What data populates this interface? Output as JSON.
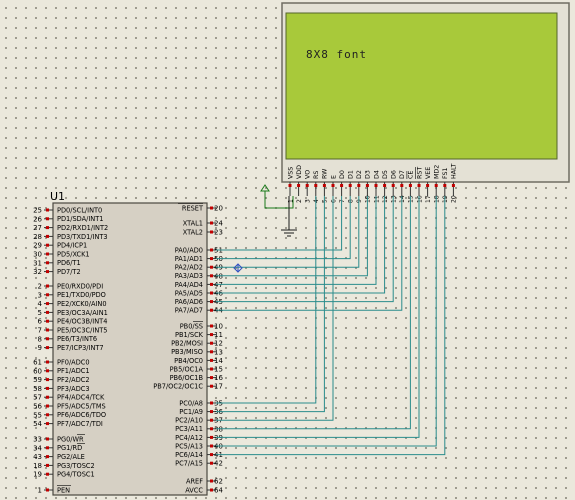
{
  "mcu": {
    "ref": "U1",
    "left_pins": [
      {
        "num": "25",
        "label": "PD0/SCL/INT0"
      },
      {
        "num": "26",
        "label": "PD1/SDA/INT1"
      },
      {
        "num": "27",
        "label": "PD2/RXD1/INT2"
      },
      {
        "num": "28",
        "label": "PD3/TXD1/INT3"
      },
      {
        "num": "29",
        "label": "PD4/ICP1"
      },
      {
        "num": "30",
        "label": "PD5/XCK1"
      },
      {
        "num": "31",
        "label": "PD6/T1"
      },
      {
        "num": "32",
        "label": "PD7/T2"
      },
      {
        "num": "2",
        "label": "PE0/RXD0/PDI"
      },
      {
        "num": "3",
        "label": "PE1/TXD0/PDO"
      },
      {
        "num": "4",
        "label": "PE2/XCK0/AIN0"
      },
      {
        "num": "5",
        "label": "PE3/OC3A/AIN1"
      },
      {
        "num": "6",
        "label": "PE4/OC3B/INT4"
      },
      {
        "num": "7",
        "label": "PE5/OC3C/INT5"
      },
      {
        "num": "8",
        "label": "PE6/T3/INT6"
      },
      {
        "num": "9",
        "label": "PE7/ICP3/INT7"
      },
      {
        "num": "61",
        "label": "PF0/ADC0"
      },
      {
        "num": "60",
        "label": "PF1/ADC1"
      },
      {
        "num": "59",
        "label": "PF2/ADC2"
      },
      {
        "num": "58",
        "label": "PF3/ADC3"
      },
      {
        "num": "57",
        "label": "PF4/ADC4/TCK"
      },
      {
        "num": "56",
        "label": "PF5/ADC5/TMS"
      },
      {
        "num": "55",
        "label": "PF6/ADC6/TDO"
      },
      {
        "num": "54",
        "label": "PF7/ADC7/TDI"
      },
      {
        "num": "33",
        "label": "PG0/WR"
      },
      {
        "num": "34",
        "label": "PG1/RD"
      },
      {
        "num": "43",
        "label": "PG2/ALE"
      },
      {
        "num": "18",
        "label": "PG3/TOSC2"
      },
      {
        "num": "19",
        "label": "PG4/TOSC1"
      },
      {
        "num": "1",
        "label": "PEN"
      }
    ],
    "right_pins": [
      {
        "num": "20",
        "label": "RESET"
      },
      {
        "num": "24",
        "label": "XTAL1"
      },
      {
        "num": "23",
        "label": "XTAL2"
      },
      {
        "num": "51",
        "label": "PA0/AD0"
      },
      {
        "num": "50",
        "label": "PA1/AD1"
      },
      {
        "num": "49",
        "label": "PA2/AD2"
      },
      {
        "num": "48",
        "label": "PA3/AD3"
      },
      {
        "num": "47",
        "label": "PA4/AD4"
      },
      {
        "num": "46",
        "label": "PA5/AD5"
      },
      {
        "num": "45",
        "label": "PA6/AD6"
      },
      {
        "num": "44",
        "label": "PA7/AD7"
      },
      {
        "num": "10",
        "label": "PB0/SS"
      },
      {
        "num": "11",
        "label": "PB1/SCK"
      },
      {
        "num": "12",
        "label": "PB2/MOSI"
      },
      {
        "num": "13",
        "label": "PB3/MISO"
      },
      {
        "num": "14",
        "label": "PB4/OC0"
      },
      {
        "num": "15",
        "label": "PB5/OC1A"
      },
      {
        "num": "16",
        "label": "PB6/OC1B"
      },
      {
        "num": "17",
        "label": "PB7/OC2/OC1C"
      },
      {
        "num": "35",
        "label": "PC0/A8"
      },
      {
        "num": "36",
        "label": "PC1/A9"
      },
      {
        "num": "37",
        "label": "PC2/A10"
      },
      {
        "num": "38",
        "label": "PC3/A11"
      },
      {
        "num": "39",
        "label": "PC4/A12"
      },
      {
        "num": "40",
        "label": "PC5/A13"
      },
      {
        "num": "41",
        "label": "PC6/A14"
      },
      {
        "num": "42",
        "label": "PC7/A15"
      },
      {
        "num": "62",
        "label": "AREF"
      },
      {
        "num": "64",
        "label": "AVCC"
      }
    ]
  },
  "lcd": {
    "text": "8X8 font",
    "pins": [
      {
        "num": "1",
        "label": "VSS"
      },
      {
        "num": "2",
        "label": "VDD"
      },
      {
        "num": "3",
        "label": "VO"
      },
      {
        "num": "4",
        "label": "RS"
      },
      {
        "num": "5",
        "label": "RW"
      },
      {
        "num": "6",
        "label": "E"
      },
      {
        "num": "7",
        "label": "D0"
      },
      {
        "num": "8",
        "label": "D1"
      },
      {
        "num": "9",
        "label": "D2"
      },
      {
        "num": "10",
        "label": "D3"
      },
      {
        "num": "11",
        "label": "D4"
      },
      {
        "num": "12",
        "label": "D5"
      },
      {
        "num": "13",
        "label": "D6"
      },
      {
        "num": "14",
        "label": "D7"
      },
      {
        "num": "15",
        "label": "CE"
      },
      {
        "num": "16",
        "label": "RST"
      },
      {
        "num": "17",
        "label": "VEE"
      },
      {
        "num": "18",
        "label": "MD2"
      },
      {
        "num": "19",
        "label": "FS1"
      },
      {
        "num": "20",
        "label": "HALT"
      }
    ]
  },
  "colors": {
    "lcd_screen": "#a8c93a",
    "lcd_body": "#e4e1d5",
    "chip_body": "#d6d0c4",
    "wire": "#2a8c8c",
    "pin_mark": "#c00000"
  }
}
